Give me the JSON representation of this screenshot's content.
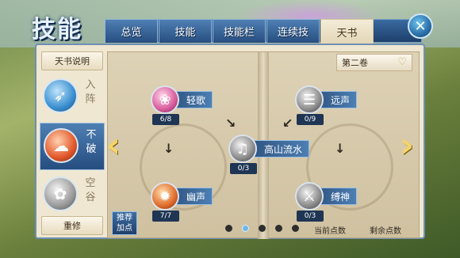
{
  "header": {
    "title": "技能",
    "tabs": [
      {
        "label": "总览",
        "active": false
      },
      {
        "label": "技能",
        "active": false
      },
      {
        "label": "技能栏",
        "active": false
      },
      {
        "label": "连续技",
        "active": false
      },
      {
        "label": "天书",
        "active": true
      }
    ],
    "close_icon": "close-icon"
  },
  "sidebar": {
    "info_button": "天书说明",
    "items": [
      {
        "label_line1": "入",
        "label_line2": "阵",
        "icon": "wing-icon",
        "active": false
      },
      {
        "label_line1": "不",
        "label_line2": "破",
        "icon": "cloud-icon",
        "active": true
      },
      {
        "label_line1": "空",
        "label_line2": "谷",
        "icon": "lotus-icon",
        "active": false
      }
    ],
    "reset_button": "重修"
  },
  "book": {
    "volume_label": "第二卷",
    "volume_icon": "heart-icon",
    "skills": [
      {
        "name": "轻歌",
        "level": "6/8",
        "icon": "fan-icon"
      },
      {
        "name": "远声",
        "level": "0/9",
        "icon": "scroll-icon"
      },
      {
        "name": "高山流水",
        "level": "0/3",
        "icon": "harp-icon"
      },
      {
        "name": "幽声",
        "level": "7/7",
        "icon": "fire-icon"
      },
      {
        "name": "缚神",
        "level": "0/3",
        "icon": "blade-icon"
      }
    ],
    "recommend_line1": "推荐",
    "recommend_line2": "加点",
    "current_points_label": "当前点数",
    "current_points_value": "",
    "remaining_points_label": "剩余点数",
    "remaining_points_value": "",
    "pagination": {
      "total": 5,
      "current": 2
    }
  },
  "colors": {
    "accent_blue": "#2c4f7c",
    "active_tab": "#f4ecd8",
    "page_arrow": "#f4d46a"
  }
}
